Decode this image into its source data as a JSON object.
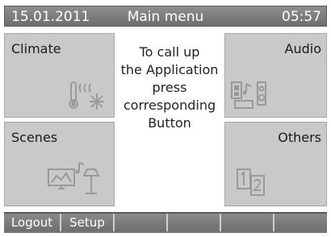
{
  "status_bar": {
    "date": "15.01.2011",
    "title": "Main menu",
    "time": "05:57"
  },
  "tiles": {
    "climate": {
      "label": "Climate",
      "icon": "thermometer-heat-snowflake-icon"
    },
    "audio": {
      "label": "Audio",
      "icon": "speaker-music-icon"
    },
    "scenes": {
      "label": "Scenes",
      "icon": "screen-lamp-scene-icon"
    },
    "others": {
      "label": "Others",
      "icon": "pages-1-2-icon"
    }
  },
  "center_message": {
    "lines": [
      "To call up",
      "the Application",
      "press",
      "corresponding",
      "Button"
    ]
  },
  "softkeys": [
    "Logout",
    "Setup",
    "",
    "",
    "",
    ""
  ],
  "colors": {
    "status_bar": "#7e7e7e",
    "tile_background": "#c9c9c9",
    "softkey": "#7c7c7c",
    "icon_gray": "#9a9a9a"
  }
}
